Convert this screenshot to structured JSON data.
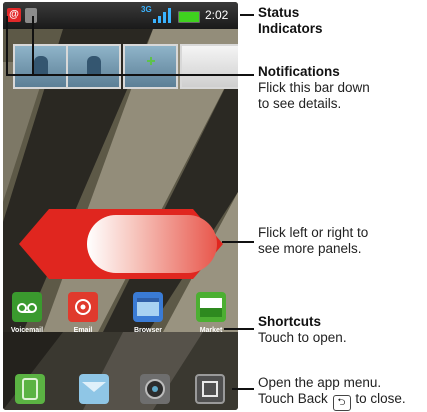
{
  "status_bar": {
    "notification_icon_names": [
      "mail-notification-icon",
      "usb-notification-icon"
    ],
    "network_type": "3G",
    "clock": "2:02"
  },
  "shortcuts": [
    {
      "label": "Voicemail",
      "icon": "voicemail-icon",
      "color": "#3a9a2e"
    },
    {
      "label": "Email",
      "icon": "email-icon",
      "color": "#e03a2d"
    },
    {
      "label": "Browser",
      "icon": "browser-icon",
      "color": "#3a7bd5"
    },
    {
      "label": "Market",
      "icon": "market-icon",
      "color": "#4caf32"
    }
  ],
  "dock": [
    {
      "icon": "phone-icon",
      "color": "#5bb343"
    },
    {
      "icon": "messaging-icon",
      "color": "#8fc6e6"
    },
    {
      "icon": "camera-icon",
      "color": "#6e6e6e"
    },
    {
      "icon": "app-menu-icon",
      "color": "#4f4f4f"
    }
  ],
  "callouts": {
    "status": {
      "title_line1": "Status",
      "title_line2": "Indicators"
    },
    "notifications": {
      "title": "Notifications",
      "line1": "Flick this bar down",
      "line2": "to see details."
    },
    "panels": {
      "line1": "Flick left or right to",
      "line2": "see more panels."
    },
    "shortcuts": {
      "title": "Shortcuts",
      "line1": "Touch to open."
    },
    "app_menu": {
      "line1": "Open the app menu.",
      "line2_before": "Touch Back",
      "line2_after": "to close."
    }
  },
  "colors": {
    "arrow_red": "#e0261f",
    "battery_green": "#3fd11f"
  }
}
